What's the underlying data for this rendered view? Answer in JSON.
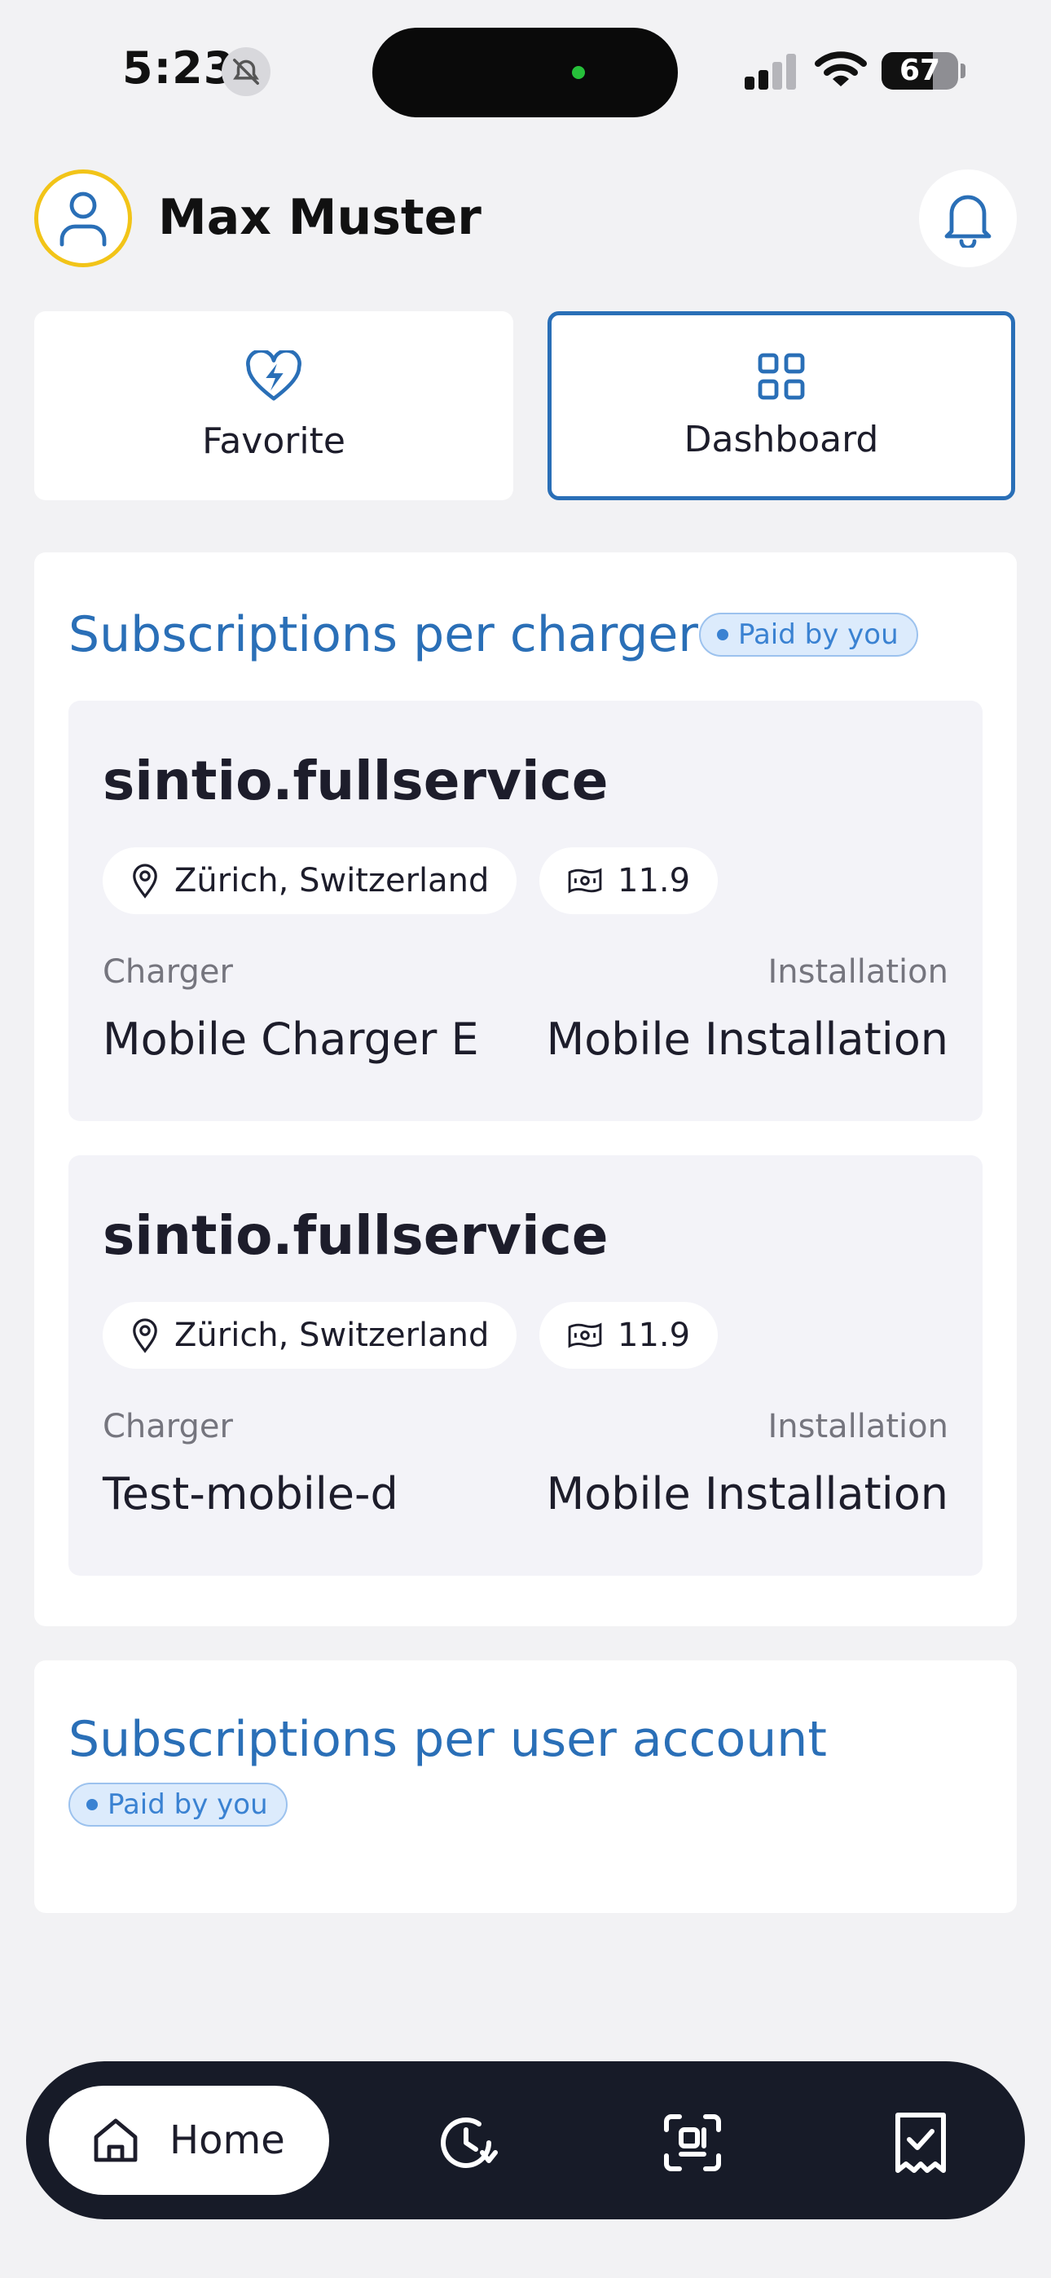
{
  "status_bar": {
    "time": "5:23",
    "battery": "67",
    "battery_percent": 67,
    "silent_icon": "bell-slash-icon",
    "signal_icon": "cellular-signal-icon",
    "wifi_icon": "wifi-icon"
  },
  "header": {
    "user_name": "Max Muster",
    "avatar_icon": "user-icon",
    "notification_icon": "bell-icon"
  },
  "tiles": {
    "favorite": {
      "label": "Favorite",
      "icon": "heart-lightning-icon"
    },
    "dashboard": {
      "label": "Dashboard",
      "icon": "grid-icon",
      "selected": true
    }
  },
  "subscriptions_per_charger": {
    "title": "Subscriptions per charger",
    "badge": "Paid by you",
    "items": [
      {
        "name": "sintio.fullservice",
        "location": "Zürich, Switzerland",
        "price": "11.9",
        "charger_label": "Charger",
        "charger_value": "Mobile Charger E",
        "installation_label": "Installation",
        "installation_value": "Mobile Installation"
      },
      {
        "name": "sintio.fullservice",
        "location": "Zürich, Switzerland",
        "price": "11.9",
        "charger_label": "Charger",
        "charger_value": "Test-mobile-d",
        "installation_label": "Installation",
        "installation_value": "Mobile Installation"
      }
    ]
  },
  "subscriptions_per_user": {
    "title": "Subscriptions per user account",
    "badge": "Paid by you"
  },
  "bottom_nav": {
    "home_label": "Home",
    "home_icon": "home-icon",
    "items": [
      "history-icon",
      "scan-icon",
      "receipt-check-icon"
    ]
  },
  "colors": {
    "accent_blue": "#2a6fb7",
    "badge_blue": "#3a82d2",
    "avatar_ring": "#f2c418",
    "nav_background": "#171b28",
    "page_background": "#f2f2f4"
  }
}
